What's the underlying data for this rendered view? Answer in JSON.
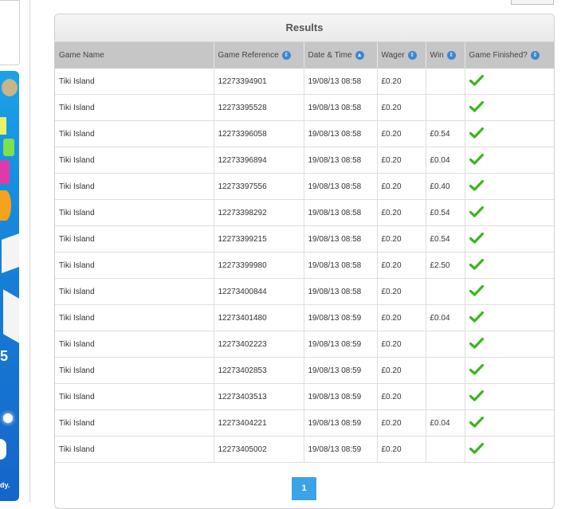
{
  "results": {
    "title": "Results",
    "columns": [
      "Game Name",
      "Game Reference",
      "Date & Time",
      "Wager",
      "Win",
      "Game Finished?"
    ],
    "rows": [
      {
        "name": "Tiki Island",
        "ref": "12273394901",
        "time": "19/08/13 08:58",
        "wager": "£0.20",
        "win": "",
        "finished": true
      },
      {
        "name": "Tiki Island",
        "ref": "12273395528",
        "time": "19/08/13 08:58",
        "wager": "£0.20",
        "win": "",
        "finished": true
      },
      {
        "name": "Tiki Island",
        "ref": "12273396058",
        "time": "19/08/13 08:58",
        "wager": "£0.20",
        "win": "£0.54",
        "finished": true
      },
      {
        "name": "Tiki Island",
        "ref": "12273396894",
        "time": "19/08/13 08:58",
        "wager": "£0.20",
        "win": "£0.04",
        "finished": true
      },
      {
        "name": "Tiki Island",
        "ref": "12273397556",
        "time": "19/08/13 08:58",
        "wager": "£0.20",
        "win": "£0.40",
        "finished": true
      },
      {
        "name": "Tiki Island",
        "ref": "12273398292",
        "time": "19/08/13 08:58",
        "wager": "£0.20",
        "win": "£0.54",
        "finished": true
      },
      {
        "name": "Tiki Island",
        "ref": "12273399215",
        "time": "19/08/13 08:58",
        "wager": "£0.20",
        "win": "£0.54",
        "finished": true
      },
      {
        "name": "Tiki Island",
        "ref": "12273399980",
        "time": "19/08/13 08:58",
        "wager": "£0.20",
        "win": "£2.50",
        "finished": true
      },
      {
        "name": "Tiki Island",
        "ref": "12273400844",
        "time": "19/08/13 08:58",
        "wager": "£0.20",
        "win": "",
        "finished": true
      },
      {
        "name": "Tiki Island",
        "ref": "12273401480",
        "time": "19/08/13 08:59",
        "wager": "£0.20",
        "win": "£0.04",
        "finished": true
      },
      {
        "name": "Tiki Island",
        "ref": "12273402223",
        "time": "19/08/13 08:59",
        "wager": "£0.20",
        "win": "",
        "finished": true
      },
      {
        "name": "Tiki Island",
        "ref": "12273402853",
        "time": "19/08/13 08:59",
        "wager": "£0.20",
        "win": "",
        "finished": true
      },
      {
        "name": "Tiki Island",
        "ref": "12273403513",
        "time": "19/08/13 08:59",
        "wager": "£0.20",
        "win": "",
        "finished": true
      },
      {
        "name": "Tiki Island",
        "ref": "12273404221",
        "time": "19/08/13 08:59",
        "wager": "£0.20",
        "win": "£0.04",
        "finished": true
      },
      {
        "name": "Tiki Island",
        "ref": "12273405002",
        "time": "19/08/13 08:59",
        "wager": "£0.20",
        "win": "",
        "finished": true
      }
    ]
  },
  "pagination": {
    "current_page": "1"
  },
  "icons": {
    "sort": "sort-arrows-icon",
    "finished": "check-icon"
  },
  "colors": {
    "check": "#3cb521",
    "header_bg": "#c6c6c6",
    "pager": "#3ba3e8",
    "sort": "#3b86d6"
  }
}
